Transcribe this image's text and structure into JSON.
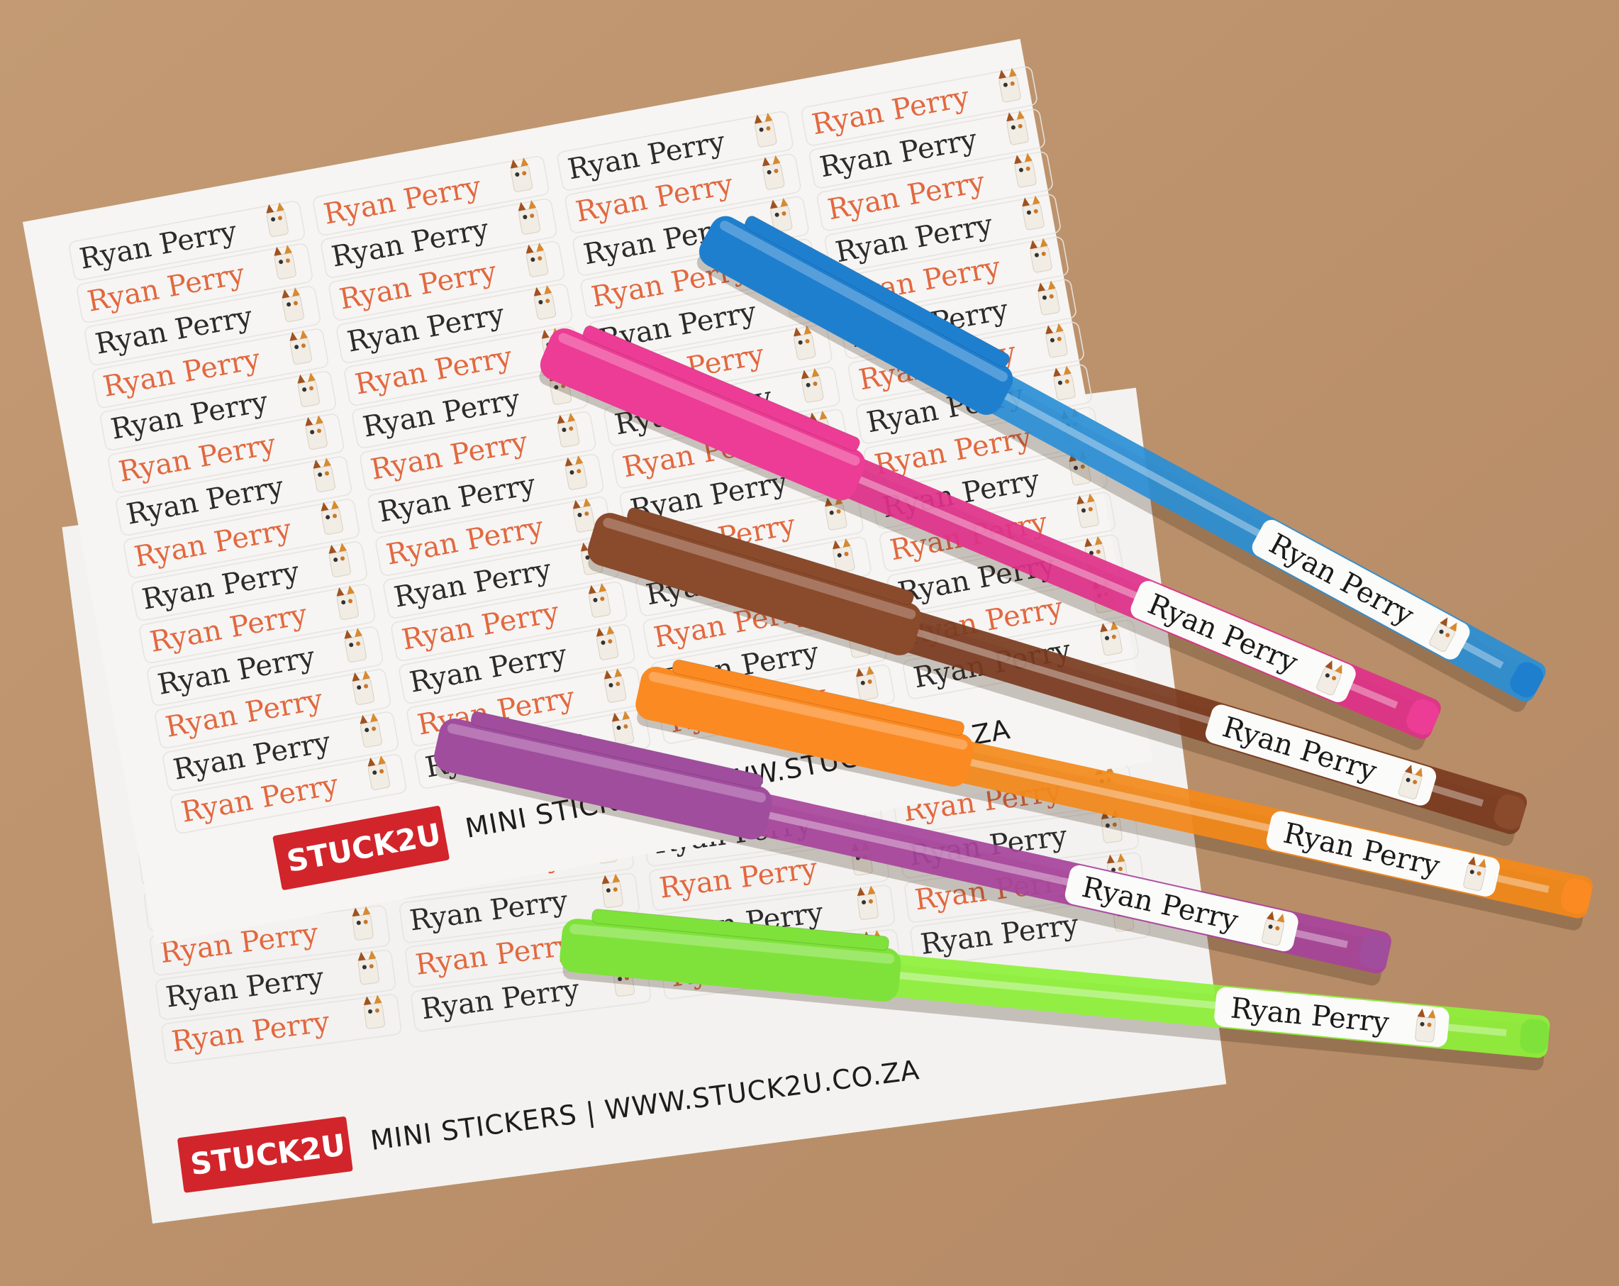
{
  "photo": {
    "background_color": "#b98f6a",
    "sticker_name": "Ryan Perry",
    "sticker_colors": [
      "#2b2b2b",
      "#e2683f"
    ],
    "sheet_color": "#f4f3f1",
    "brand": {
      "logo_text": "STUCK2U",
      "logo_color": "#d1252b",
      "tagline": "MINI STICKERS | WWW.STUCK2U.CO.ZA"
    },
    "pens": [
      {
        "color": "blue",
        "body": "#2a8fd6",
        "cap": "#1f7fcf",
        "label": "Ryan Perry"
      },
      {
        "color": "pink",
        "body": "#e0318a",
        "cap": "#ec3c95",
        "label": "Ryan Perry"
      },
      {
        "color": "brown",
        "body": "#7a3b1f",
        "cap": "#8a4a2c",
        "label": "Ryan Perry"
      },
      {
        "color": "orange",
        "body": "#f3891a",
        "cap": "#fb8a22",
        "label": "Ryan Perry"
      },
      {
        "color": "purple",
        "body": "#a7439b",
        "cap": "#a04d9e",
        "label": "Ryan Perry"
      },
      {
        "color": "green",
        "body": "#8ef23a",
        "cap": "#7ee23a",
        "label": "Ryan Perry"
      }
    ]
  }
}
